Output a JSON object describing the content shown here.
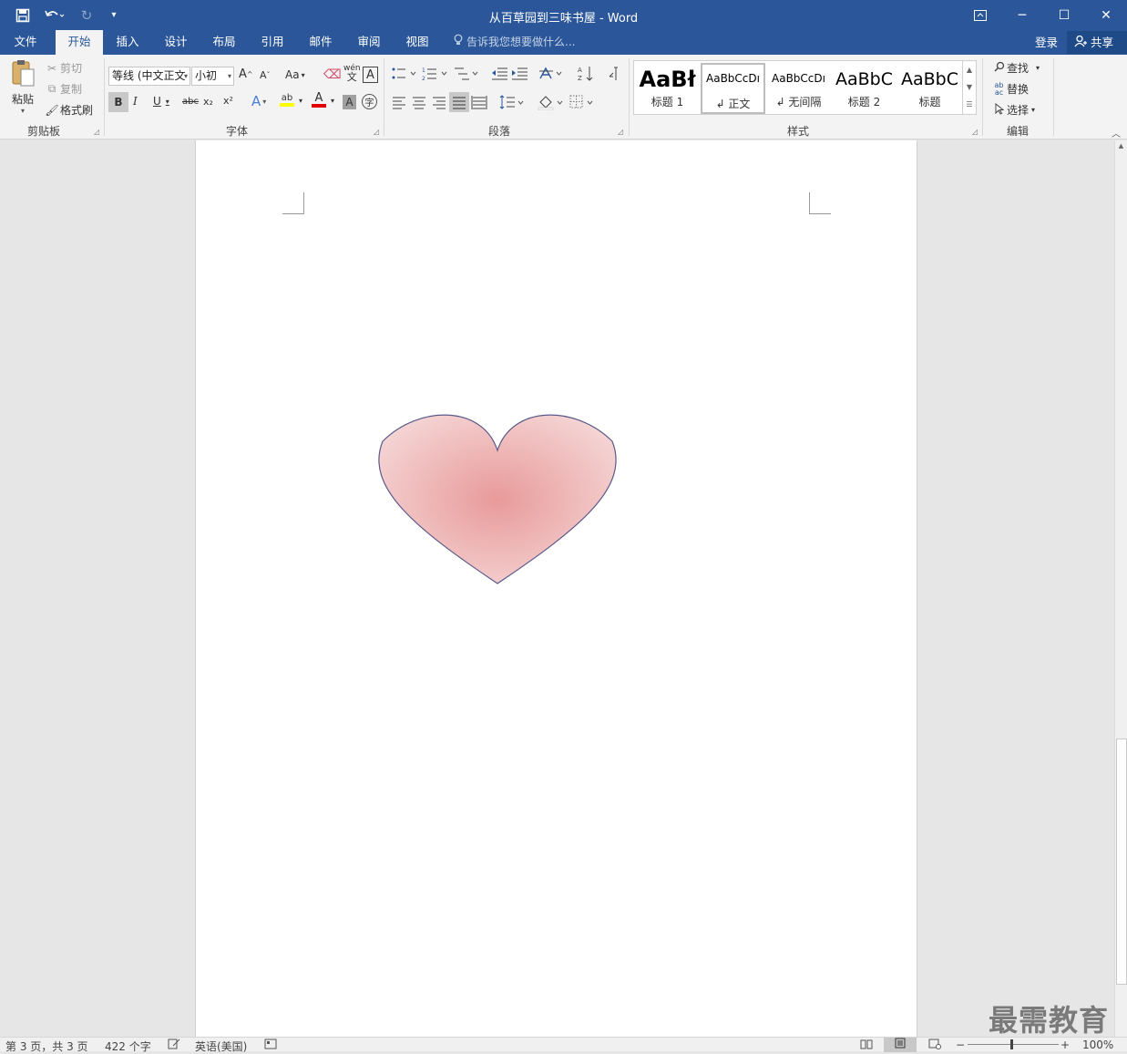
{
  "window": {
    "title": "从百草园到三味书屋 - Word"
  },
  "quick_access": {
    "save_icon": "save-icon",
    "undo_icon": "undo-icon",
    "redo_icon": "redo-icon",
    "customize_icon": "customize-qat-icon"
  },
  "window_controls": {
    "ribbon_display_icon": "ribbon-display-icon",
    "minimize": "─",
    "maximize": "☐",
    "close": "✕"
  },
  "tabs": [
    "文件",
    "开始",
    "插入",
    "设计",
    "布局",
    "引用",
    "邮件",
    "审阅",
    "视图"
  ],
  "active_tab": "开始",
  "tell_me": "告诉我您想要做什么...",
  "account": {
    "login": "登录",
    "share": "共享"
  },
  "clipboard": {
    "paste": "粘贴",
    "cut": "剪切",
    "copy": "复制",
    "format_painter": "格式刷",
    "label": "剪贴板"
  },
  "font": {
    "name": "等线 (中文正文",
    "size": "小初",
    "label": "字体",
    "grow": "A",
    "shrink": "A",
    "case": "Aa",
    "bold": "B",
    "italic": "I",
    "underline": "U",
    "strike": "abc",
    "subscript": "x₂",
    "superscript": "x²",
    "phonetic": "wén",
    "phonetic_char": "文",
    "border_char": "A",
    "effects": "A",
    "highlight": "ab",
    "color": "A",
    "shading": "A",
    "enclose": "字"
  },
  "paragraph": {
    "label": "段落"
  },
  "styles": {
    "label": "样式",
    "items": [
      {
        "preview": "AaBł",
        "name": "标题 1"
      },
      {
        "preview": "AaBbCcDı",
        "name": "↲ 正文"
      },
      {
        "preview": "AaBbCcDı",
        "name": "↲ 无间隔"
      },
      {
        "preview": "AaBbC",
        "name": "标题 2"
      },
      {
        "preview": "AaBbC",
        "name": "标题"
      }
    ]
  },
  "editing": {
    "find": "查找",
    "replace": "替换",
    "select": "选择",
    "label": "编辑"
  },
  "document": {
    "shape": "heart",
    "fill_center": "#e89a9a",
    "fill_edge": "#f5d5d5",
    "stroke": "#5a5a8a"
  },
  "status": {
    "page": "第 3 页，共 3 页",
    "words": "422 个字",
    "language": "英语(美国)",
    "zoom": "100%"
  },
  "watermark": "最需教育"
}
